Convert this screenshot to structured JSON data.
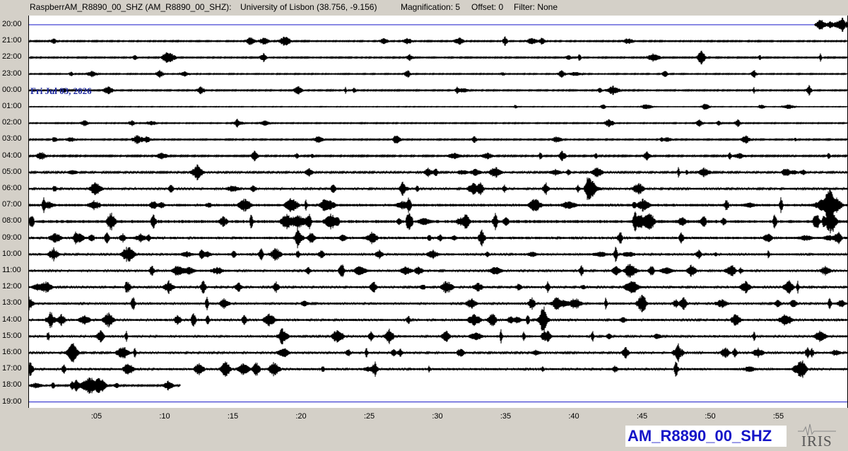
{
  "header": {
    "station": "RaspberrAM_R8890_00_SHZ (AM_R8890_00_SHZ):",
    "location": "University of Lisbon (38.756, -9.156)",
    "magnification": "Magnification: 5",
    "offset": "Offset: 0",
    "filter": "Filter: None"
  },
  "hours": [
    "20:00",
    "21:00",
    "22:00",
    "23:00",
    "00:00",
    "01:00",
    "02:00",
    "03:00",
    "04:00",
    "05:00",
    "06:00",
    "07:00",
    "08:00",
    "09:00",
    "10:00",
    "11:00",
    "12:00",
    "13:00",
    "14:00",
    "15:00",
    "16:00",
    "17:00",
    "18:00",
    "19:00"
  ],
  "trace_amplitude": [
    0.2,
    0.3,
    0.3,
    0.25,
    0.3,
    0.15,
    0.25,
    0.3,
    0.35,
    0.45,
    0.5,
    0.65,
    0.75,
    0.6,
    0.55,
    0.55,
    0.5,
    0.55,
    0.55,
    0.55,
    0.5,
    0.55,
    0.35,
    0
  ],
  "trace_coverage": [
    {
      "from": 0.96,
      "to": 1.0
    },
    {
      "from": 0,
      "to": 1
    },
    {
      "from": 0,
      "to": 1
    },
    {
      "from": 0,
      "to": 1
    },
    {
      "from": 0,
      "to": 1
    },
    {
      "from": 0,
      "to": 1
    },
    {
      "from": 0,
      "to": 1
    },
    {
      "from": 0,
      "to": 1
    },
    {
      "from": 0,
      "to": 1
    },
    {
      "from": 0,
      "to": 1
    },
    {
      "from": 0,
      "to": 1
    },
    {
      "from": 0,
      "to": 1
    },
    {
      "from": 0,
      "to": 1
    },
    {
      "from": 0,
      "to": 1
    },
    {
      "from": 0,
      "to": 1
    },
    {
      "from": 0,
      "to": 1
    },
    {
      "from": 0,
      "to": 1
    },
    {
      "from": 0,
      "to": 1
    },
    {
      "from": 0,
      "to": 1
    },
    {
      "from": 0,
      "to": 1
    },
    {
      "from": 0,
      "to": 1
    },
    {
      "from": 0,
      "to": 1
    },
    {
      "from": 0,
      "to": 0.185
    },
    {
      "from": 0,
      "to": 0
    }
  ],
  "xaxis": {
    "labels": [
      ":05",
      ":10",
      ":15",
      ":20",
      ":25",
      ":30",
      ":35",
      ":40",
      ":45",
      ":50",
      ":55"
    ],
    "minutes": [
      5,
      10,
      15,
      20,
      25,
      30,
      35,
      40,
      45,
      50,
      55
    ]
  },
  "date_label": "Fri Jul 03, 2026",
  "station_label": "AM_R8890_00_SHZ",
  "logo_text": "IRIS",
  "colors": {
    "background": "#d4d0c8",
    "trace": "#000000",
    "boundary_line": "#1515c8",
    "date": "#1e2aa0",
    "station": "#1515c8"
  }
}
